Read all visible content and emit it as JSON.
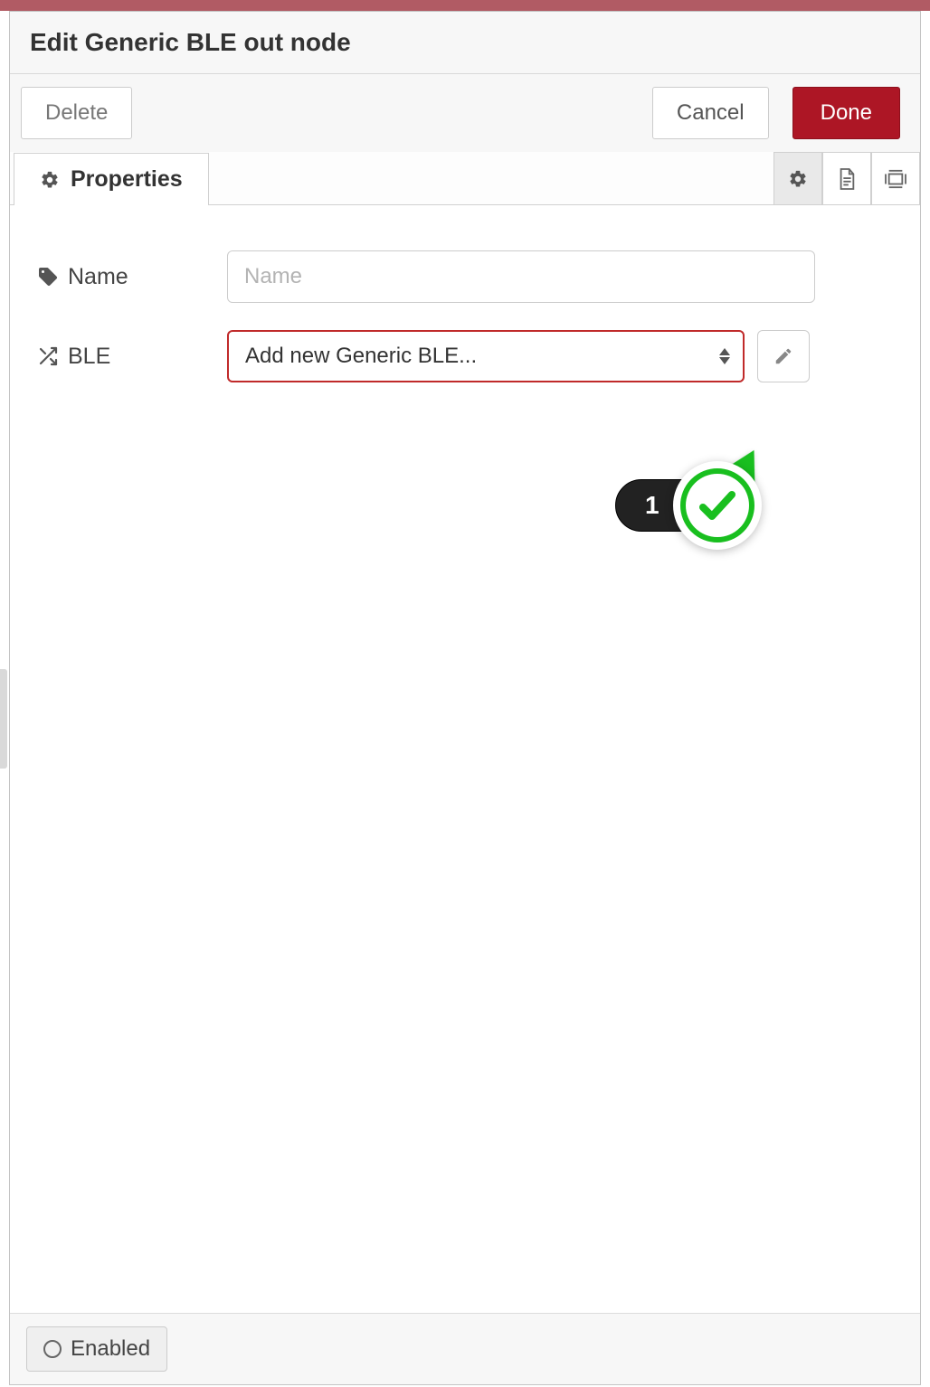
{
  "header": {
    "title": "Edit Generic BLE out node"
  },
  "actions": {
    "delete": "Delete",
    "cancel": "Cancel",
    "done": "Done"
  },
  "tabs": {
    "properties": "Properties"
  },
  "form": {
    "name_label": "Name",
    "name_placeholder": "Name",
    "name_value": "",
    "ble_label": "BLE",
    "ble_selected": "Add new Generic BLE..."
  },
  "callout": {
    "step": "1"
  },
  "footer": {
    "enabled": "Enabled"
  }
}
